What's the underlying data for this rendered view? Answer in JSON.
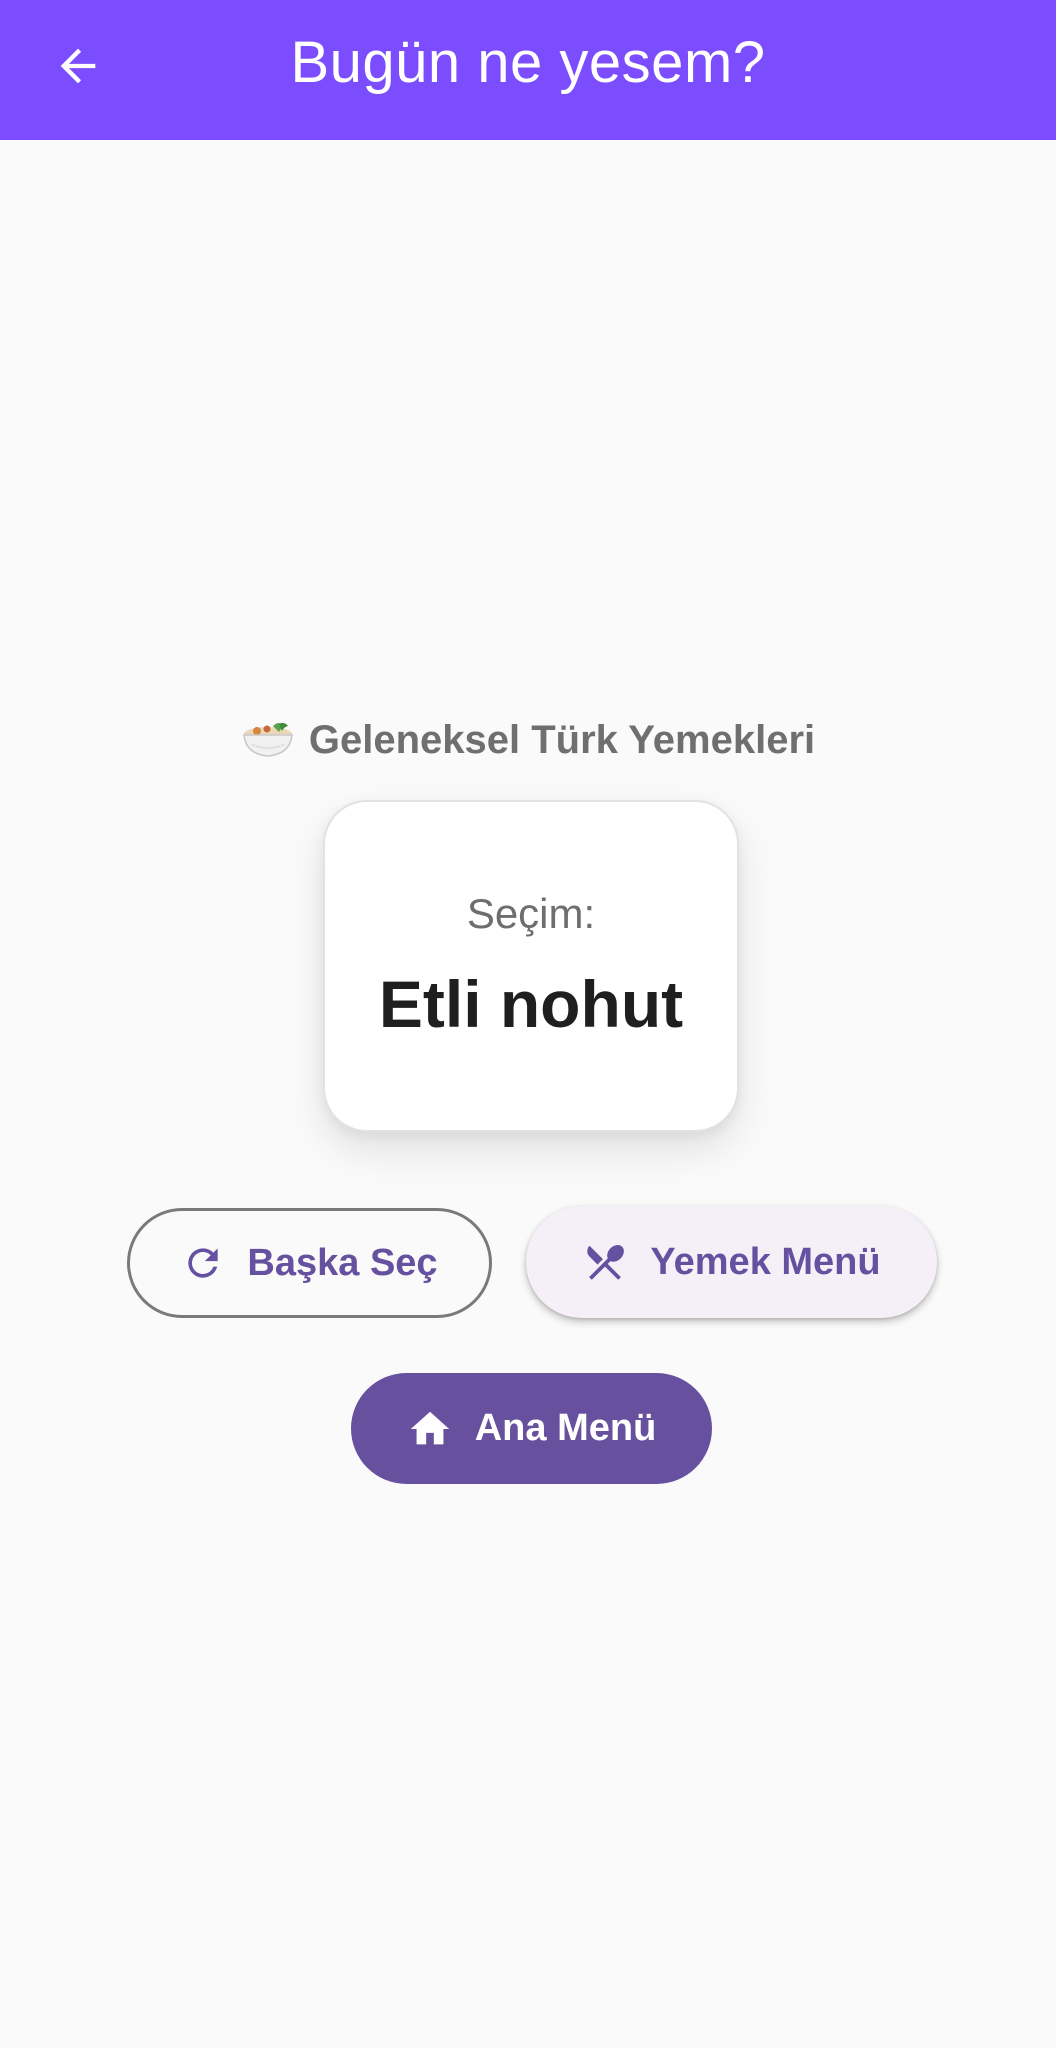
{
  "appbar": {
    "title": "Bugün ne yesem?",
    "back_icon": "arrow-back-icon",
    "background": "#7c4dff"
  },
  "category": {
    "emoji": "🥗",
    "icon": "bowl-icon",
    "label": "Geleneksel Türk Yemekleri"
  },
  "selection_card": {
    "label": "Seçim:",
    "value": "Etli nohut"
  },
  "buttons": {
    "pick_another": {
      "label": "Başka Seç",
      "icon": "refresh-icon"
    },
    "food_menu": {
      "label": "Yemek Menü",
      "icon": "utensils-crossed-icon"
    },
    "main_menu": {
      "label": "Ana Menü",
      "icon": "home-icon"
    }
  },
  "colors": {
    "accent": "#7c4dff",
    "primary": "#67519f",
    "tonal_bg": "#f5f0f8",
    "background": "#fafafa"
  }
}
